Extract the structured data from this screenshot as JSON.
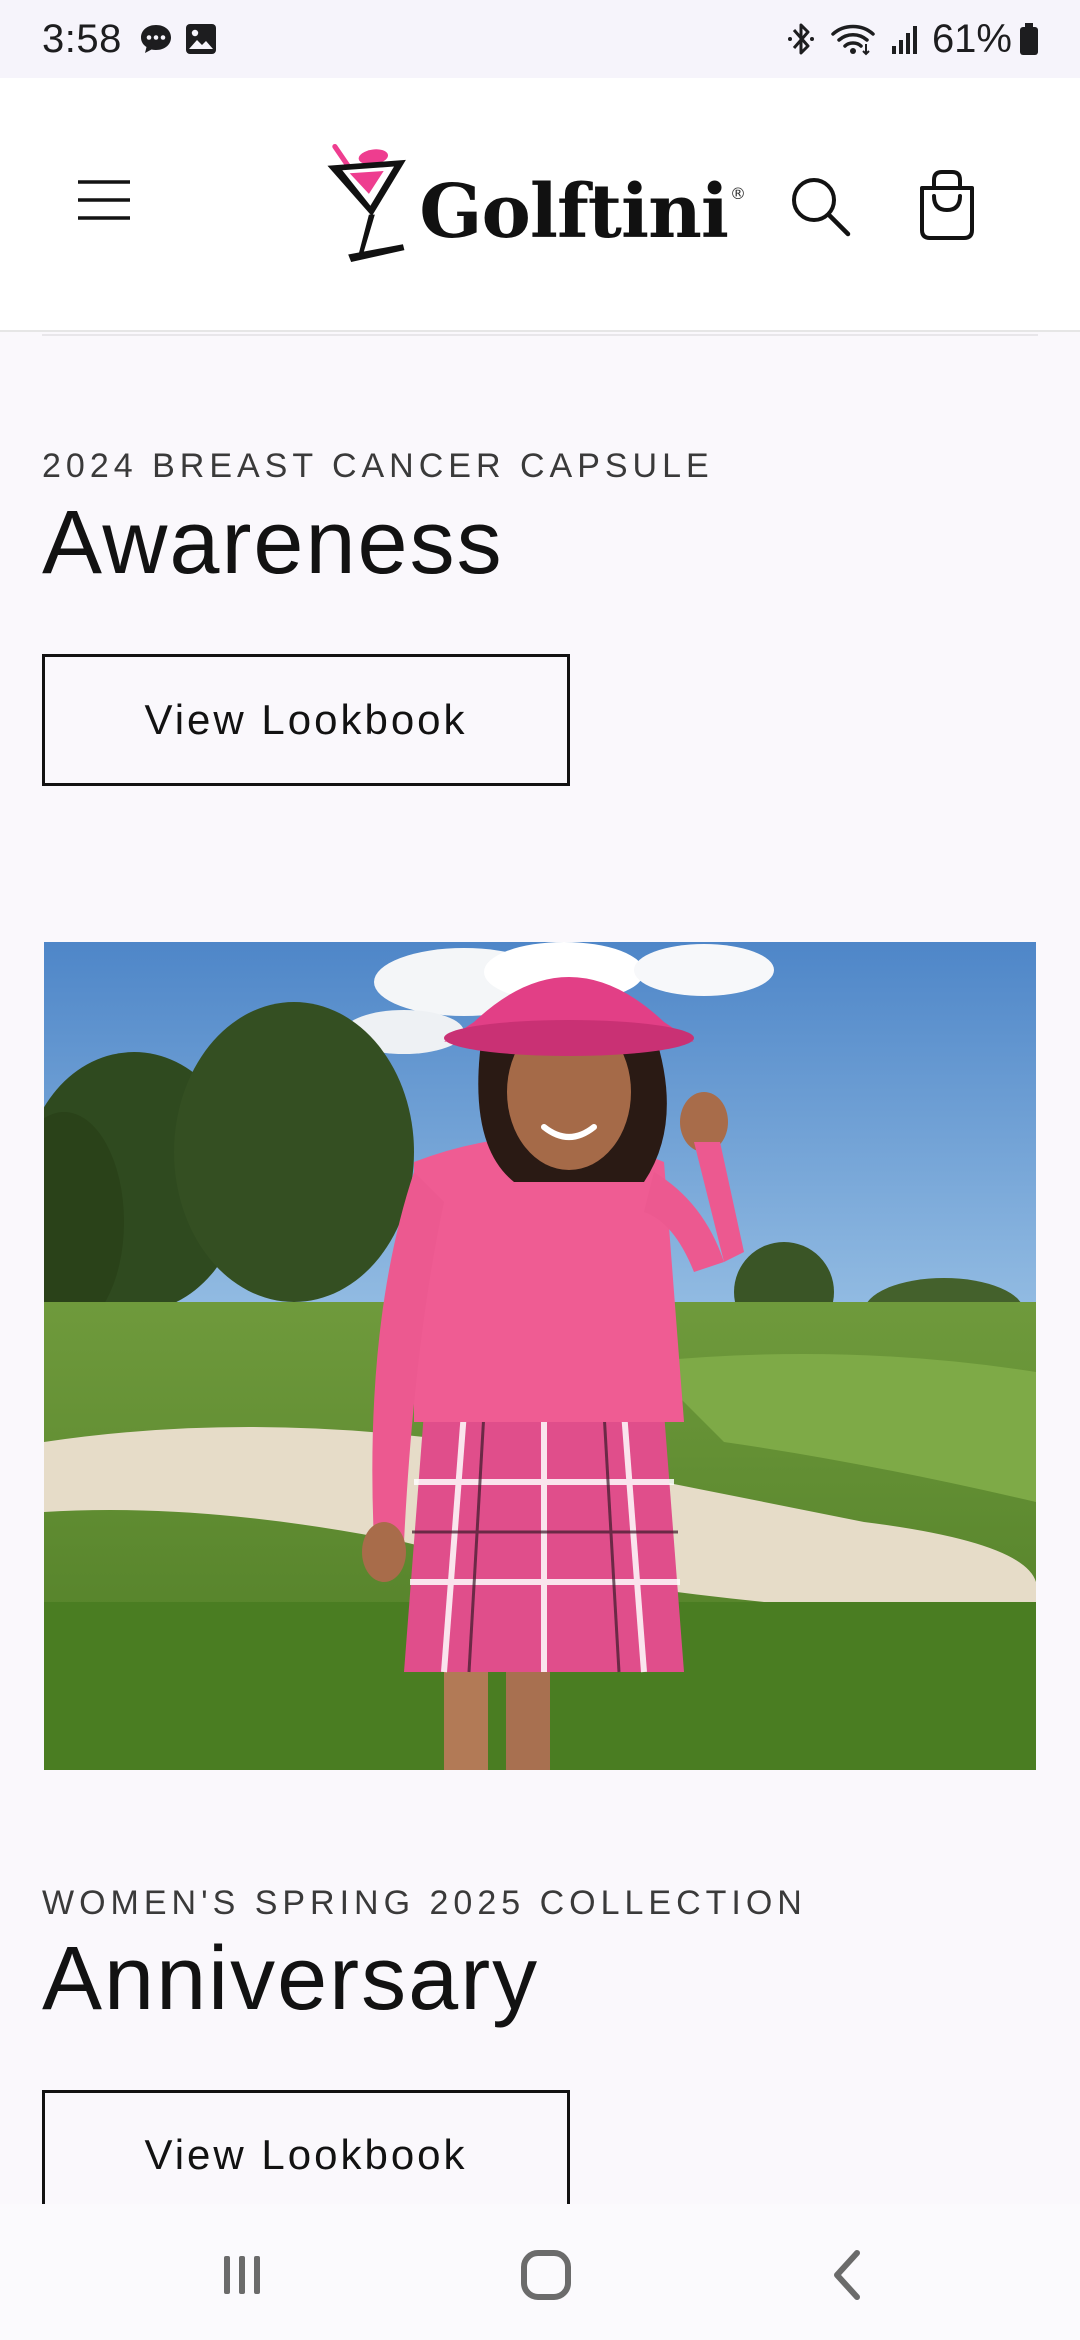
{
  "status_bar": {
    "time": "3:58",
    "battery_percent": "61%",
    "icons": [
      "message-icon",
      "image-icon",
      "bluetooth-icon",
      "wifi-icon",
      "signal-icon",
      "battery-icon"
    ]
  },
  "header": {
    "logo_text": "Golftini",
    "logo_registered": "®",
    "icons": [
      "menu-icon",
      "search-icon",
      "cart-icon"
    ],
    "brand_colors": {
      "pink": "#ee3d8f",
      "black": "#111111"
    }
  },
  "sections": [
    {
      "kicker": "2024 BREAST CANCER CAPSULE",
      "headline": "Awareness",
      "button_label": "View Lookbook"
    },
    {
      "kicker": "WOMEN'S SPRING 2025 COLLECTION",
      "headline": "Anniversary",
      "button_label": "View Lookbook"
    }
  ],
  "android_nav": {
    "icons": [
      "recent-apps-icon",
      "home-icon",
      "back-icon"
    ]
  }
}
